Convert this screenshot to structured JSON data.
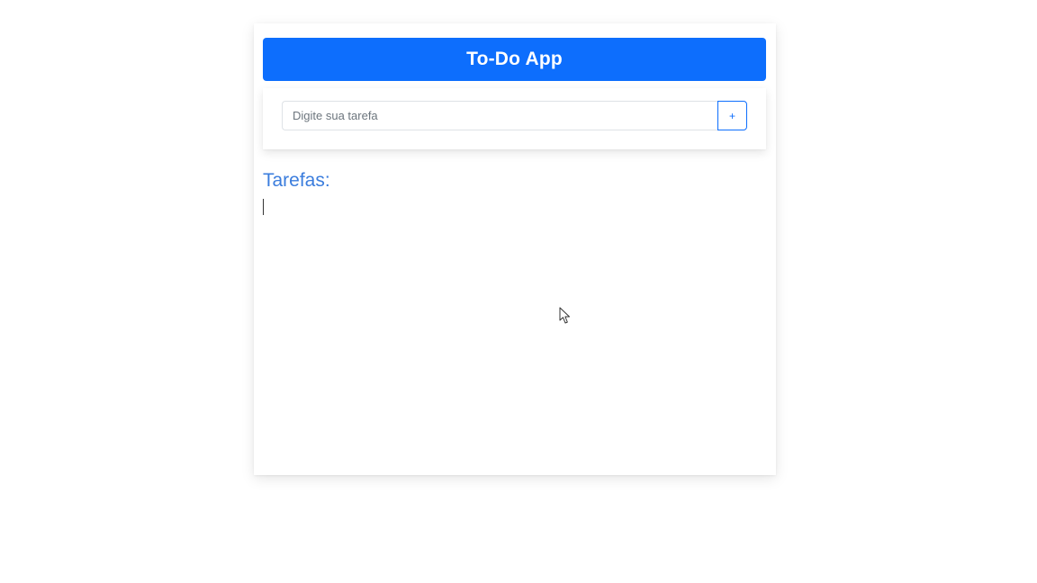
{
  "app": {
    "title": "To-Do App"
  },
  "task_form": {
    "input_value": "",
    "input_placeholder": "Digite sua tarefa",
    "add_button_label": "+"
  },
  "tasks_section": {
    "heading": "Tarefas:",
    "items": []
  },
  "colors": {
    "primary": "#0d6efd",
    "heading": "#3b7ddd",
    "background": "#ffffff"
  },
  "icons": {
    "pointer": "mouse-pointer-icon"
  }
}
